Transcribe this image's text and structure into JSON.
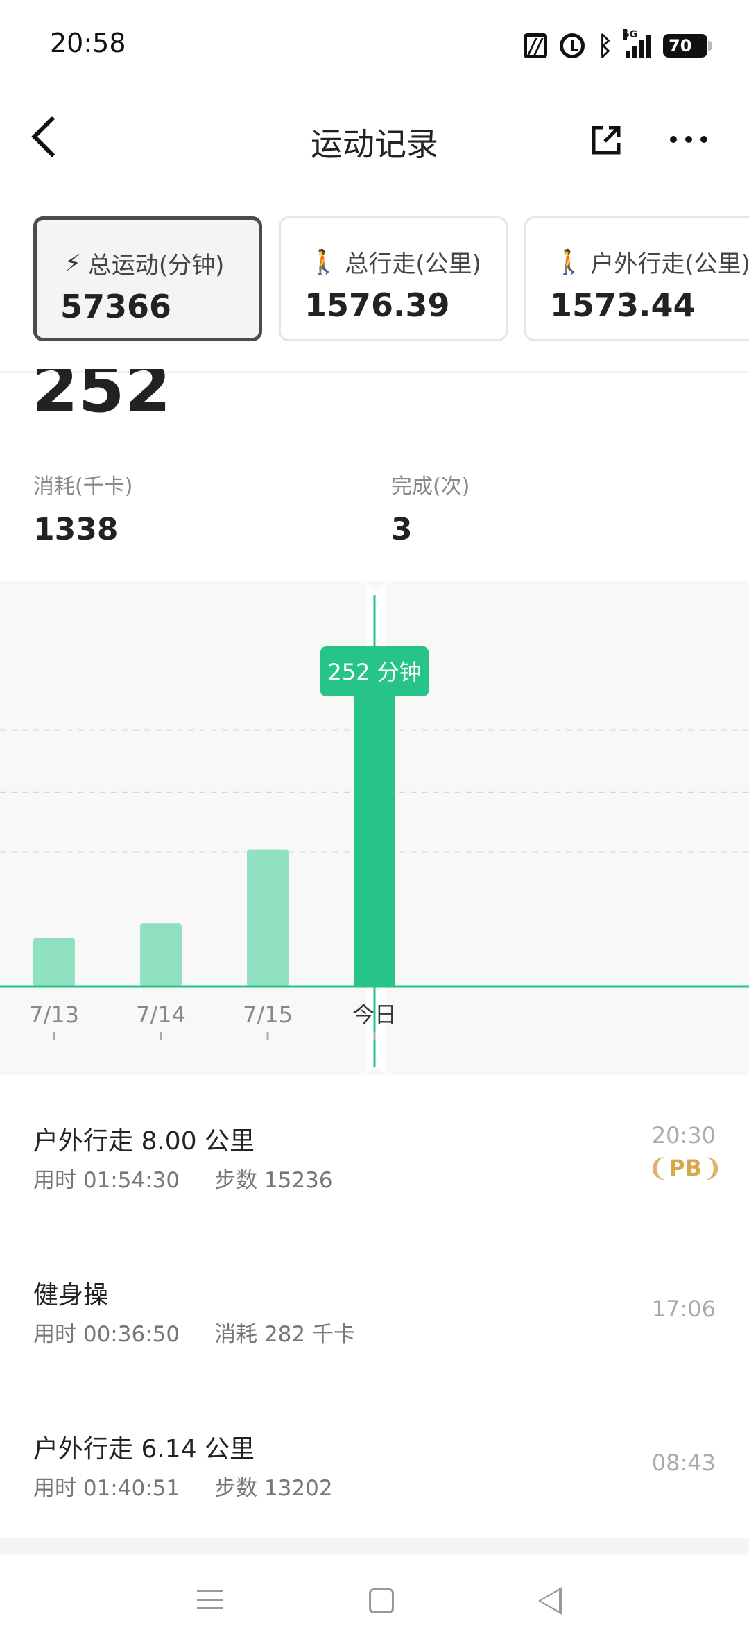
{
  "status_bar": {
    "time": "20:58",
    "battery": "70",
    "network": "5G"
  },
  "header": {
    "title": "运动记录"
  },
  "cards": [
    {
      "label": "总运动(分钟)",
      "value": "57366",
      "icon": "lightning-icon",
      "active": true
    },
    {
      "label": "总行走(公里)",
      "value": "1576.39",
      "icon": "walk-icon",
      "active": false
    },
    {
      "label": "户外行走(公里)",
      "value": "1573.44",
      "icon": "walk-icon",
      "active": false
    }
  ],
  "summary": {
    "big_value": "252",
    "stats": [
      {
        "label": "消耗(千卡)",
        "value": "1338"
      },
      {
        "label": "完成(次)",
        "value": "3"
      }
    ]
  },
  "chart_data": {
    "type": "bar",
    "categories": [
      "7/13",
      "7/14",
      "7/15",
      "今日"
    ],
    "values": [
      40,
      52,
      113,
      252
    ],
    "selected_index": 3,
    "tooltip": "252 分钟",
    "ylim": [
      0,
      300
    ],
    "grid": true,
    "colors": {
      "bar": "#8fe1c1",
      "selected": "#27c489",
      "axis": "#27c489",
      "grid": "#d6d6d6"
    }
  },
  "records": [
    {
      "title": "户外行走 8.00 公里",
      "detail1": "用时 01:54:30",
      "detail2": "步数 15236",
      "time": "20:30",
      "badge": "PB"
    },
    {
      "title": "健身操",
      "detail1": "用时 00:36:50",
      "detail2": "消耗 282 千卡",
      "time": "17:06"
    },
    {
      "title": "户外行走 6.14 公里",
      "detail1": "用时 01:40:51",
      "detail2": "步数 13202",
      "time": "08:43"
    }
  ]
}
